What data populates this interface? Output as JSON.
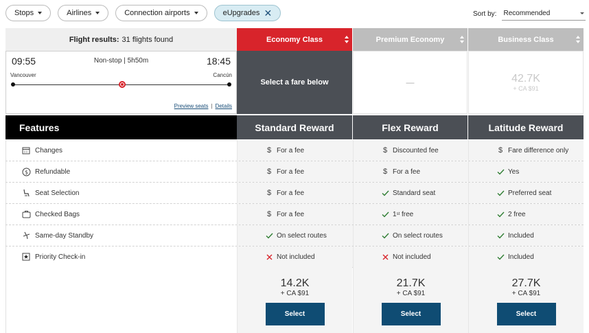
{
  "filters": [
    {
      "label": "Stops",
      "active": false
    },
    {
      "label": "Airlines",
      "active": false
    },
    {
      "label": "Connection airports",
      "active": false
    },
    {
      "label": "eUpgrades",
      "active": true
    }
  ],
  "sort": {
    "label": "Sort by:",
    "value": "Recommended"
  },
  "results": {
    "label": "Flight results:",
    "count_text": "31 flights found"
  },
  "cabins": [
    {
      "name": "Economy Class",
      "color": "#d8242b"
    },
    {
      "name": "Premium Economy",
      "color": "#bdbdbd"
    },
    {
      "name": "Business Class",
      "color": "#bdbdbd"
    }
  ],
  "flight": {
    "departure_time": "09:55",
    "arrival_time": "18:45",
    "info": "Non-stop | 5h50m",
    "origin": "Vancouver",
    "destination": "Cancún",
    "preview_link": "Preview seats",
    "separator": "|",
    "details_link": "Details"
  },
  "economy_cell": {
    "text": "Select a fare below"
  },
  "premium_cell": {
    "text": "—"
  },
  "business_cell": {
    "points": "42.7K",
    "tax": "+ CA $91"
  },
  "features_header": "Features",
  "fares": [
    {
      "name": "Standard Reward",
      "points": "14.2K",
      "tax": "+ CA $91",
      "button": "Select"
    },
    {
      "name": "Flex Reward",
      "points": "21.7K",
      "tax": "+ CA $91",
      "button": "Select"
    },
    {
      "name": "Latitude Reward",
      "points": "27.7K",
      "tax": "+ CA $91",
      "button": "Select"
    }
  ],
  "features": [
    {
      "name": "Changes",
      "icon": "calendar-icon",
      "values": [
        {
          "text": "For a fee",
          "icon": "dollar-icon"
        },
        {
          "text": "Discounted fee",
          "icon": "dollar-icon"
        },
        {
          "text": "Fare difference only",
          "icon": "dollar-icon"
        }
      ]
    },
    {
      "name": "Refundable",
      "icon": "refund-icon",
      "values": [
        {
          "text": "For a fee",
          "icon": "dollar-icon"
        },
        {
          "text": "For a fee",
          "icon": "dollar-icon"
        },
        {
          "text": "Yes",
          "icon": "check-icon"
        }
      ]
    },
    {
      "name": "Seat Selection",
      "icon": "seat-icon",
      "values": [
        {
          "text": "For a fee",
          "icon": "dollar-icon"
        },
        {
          "text": "Standard seat",
          "icon": "check-icon"
        },
        {
          "text": "Preferred seat",
          "icon": "check-icon"
        }
      ]
    },
    {
      "name": "Checked Bags",
      "icon": "bag-icon",
      "values": [
        {
          "text": "For a fee",
          "icon": "dollar-icon"
        },
        {
          "text": "1",
          "sup": "st",
          "tail": " free",
          "icon": "check-icon"
        },
        {
          "text": "2 free",
          "icon": "check-icon"
        }
      ]
    },
    {
      "name": "Same-day Standby",
      "icon": "standby-icon",
      "values": [
        {
          "text": "On select routes",
          "icon": "check-icon"
        },
        {
          "text": "On select routes",
          "icon": "check-icon"
        },
        {
          "text": "Included",
          "icon": "check-icon"
        }
      ]
    },
    {
      "name": "Priority Check-in",
      "icon": "priority-icon",
      "values": [
        {
          "text": "Not included",
          "icon": "cross-icon"
        },
        {
          "text": "Not included",
          "icon": "cross-icon"
        },
        {
          "text": "Included",
          "icon": "check-icon"
        }
      ]
    }
  ],
  "colors": {
    "accent": "#d8242b",
    "dark": "#4b4f55",
    "button": "#0f4c73",
    "check": "#2e7d32",
    "cross": "#d8242b"
  }
}
